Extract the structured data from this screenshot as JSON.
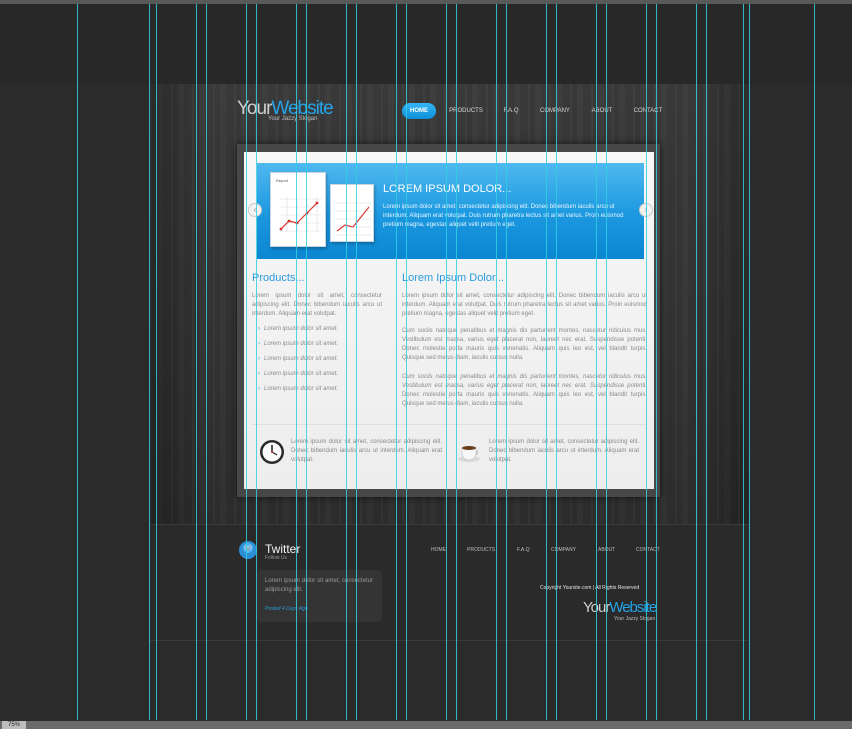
{
  "header": {
    "logo": {
      "part1": "Your",
      "part2": "Website"
    },
    "slogan": "Your Jazzy Slogan",
    "nav": [
      "HOME",
      "PRODUCTS",
      "F.A.Q",
      "COMPANY",
      "ABOUT",
      "CONTACT"
    ],
    "active_nav": "HOME"
  },
  "banner": {
    "title": "LOREM IPSUM DOLOR...",
    "text": "Lorem ipsum dolor sit amet, consectetur adipiscing elit. Donec bibendum iaculis arcu ut interdum. Aliquam erat volutpat. Duis rutrum pharetra lectus sit amet varius. Proin euismod pretium magna, egestas aliquet velit pretium eget.",
    "doc_title": "Report",
    "prev": "‹",
    "next": "›"
  },
  "products": {
    "heading": "Products...",
    "intro": "Lorem ipsum dolor sit amet, consectetur adipiscing elit. Donec bibendum iaculis arcu ut interdum. Aliquam erat volutpat.",
    "items": [
      "Lorem ipsum dolor sit amet.",
      "Lorem ipsum dolor sit amet.",
      "Lorem ipsum dolor sit amet.",
      "Lorem ipsum dolor sit amet.",
      "Lorem ipsum dolor sit amet."
    ]
  },
  "content": {
    "heading": "Lorem Ipsum Dolor...",
    "p1": "Lorem ipsum dolor sit amet, consectetur adipiscing elit. Donec bibendum iaculis arcu ut interdum. Aliquam erat volutpat. Duis rutrum pharetra lectus sit amet varius. Proin euismod pretium magna, egestas aliquet velit pretium eget.",
    "p2": "Cum sociis natoque penatibus et magnis dis parturient montes, nascetur ridiculus mus. Vestibulum est massa, varius eget placerat non, laoreet nec erat. Suspendisse potenti. Donec molestie porta mauris quis venenatis. Aliquam quis leo est, vel blandit turpis. Quisque sed metus diam, iaculis cursus nulla.",
    "p3_italic": "Cum sociis natoque penatibus et magnis dis parturient montes, nascetur ridiculus mus. Vestibulum est massa, varius eget placerat non, laoreet nec erat. Suspendisse potenti.",
    "p3_rest": "Donec molestie porta mauris quis venenatis. Aliquam quis leo est, vel blandit turpis. Quisque sed metus diam, iaculis cursus nulla."
  },
  "features": [
    {
      "icon": "clock-icon",
      "text": "Lorem ipsum dolor sit amet, consectetur adipiscing elit. Donec bibendum iaculis arcu ut interdum. Aliquam erat volutpat."
    },
    {
      "icon": "coffee-icon",
      "text": "Lorem ipsum dolor sit amet, consectetur adipiscing elit. Donec bibendum iaculis arcu ut interdum. Aliquam erat volutpat."
    }
  ],
  "footer": {
    "twitter_title": "Twitter",
    "twitter_sub": "Follow Us",
    "tweet": "Lorem ipsum dolor sit amet, consectetur adipiscing elit.",
    "tweet_time": "Posted 4 Days Ago",
    "nav": [
      "HOME",
      "PRODUCTS",
      "F.A.Q",
      "COMPANY",
      "ABOUT",
      "CONTACT"
    ],
    "copyright": "Copyright Yoursite.com | All Rights Reserved",
    "logo": {
      "part1": "Your",
      "part2": "Website"
    },
    "slogan": "Your Jazzy Slogan"
  },
  "status": {
    "zoom": "75%"
  },
  "colors": {
    "accent": "#24a3e8",
    "guide": "#2fd0e0",
    "background": "#2b2b2b"
  }
}
